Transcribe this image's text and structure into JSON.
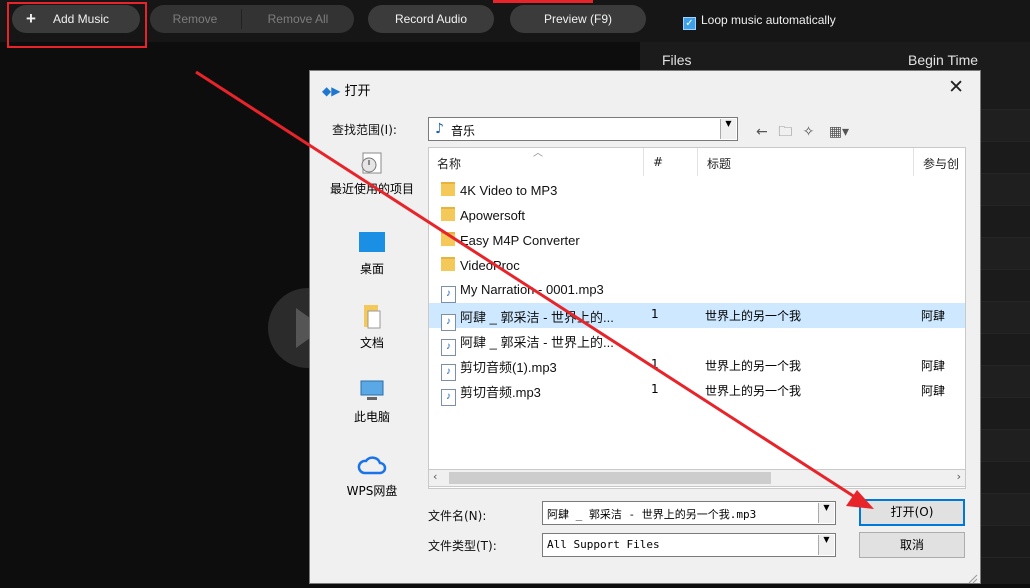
{
  "toolbar": {
    "add_music": "Add Music",
    "remove": "Remove",
    "remove_all": "Remove All",
    "record_audio": "Record Audio",
    "preview": "Preview (F9)",
    "loop_label": "Loop music automatically",
    "loop_checked": true
  },
  "right_panel": {
    "col_files": "Files",
    "col_begin": "Begin Time"
  },
  "dialog": {
    "title": "打开",
    "look_in_label": "查找范围(I):",
    "look_in_value": "音乐",
    "places": [
      {
        "label": "最近使用的项目",
        "icon": "recent-icon"
      },
      {
        "label": "桌面",
        "icon": "desktop-icon"
      },
      {
        "label": "文档",
        "icon": "documents-icon"
      },
      {
        "label": "此电脑",
        "icon": "computer-icon"
      },
      {
        "label": "WPS网盘",
        "icon": "cloud-icon"
      }
    ],
    "columns": {
      "name": "名称",
      "num": "#",
      "title": "标题",
      "artist": "参与创"
    },
    "files": [
      {
        "name": "4K Video to MP3",
        "type": "folder",
        "num": "",
        "title": "",
        "artist": ""
      },
      {
        "name": "Apowersoft",
        "type": "folder",
        "num": "",
        "title": "",
        "artist": ""
      },
      {
        "name": "Easy M4P Converter",
        "type": "folder",
        "num": "",
        "title": "",
        "artist": ""
      },
      {
        "name": "VideoProc",
        "type": "folder",
        "num": "",
        "title": "",
        "artist": ""
      },
      {
        "name": "My Narration - 0001.mp3",
        "type": "audio",
        "num": "",
        "title": "",
        "artist": ""
      },
      {
        "name": "阿肆 _ 郭采洁 - 世界上的...",
        "type": "audio",
        "num": "1",
        "title": "世界上的另一个我",
        "artist": "阿肆",
        "selected": true
      },
      {
        "name": "阿肆 _ 郭采洁 - 世界上的...",
        "type": "audio",
        "num": "",
        "title": "",
        "artist": ""
      },
      {
        "name": "剪切音频(1).mp3",
        "type": "audio",
        "num": "1",
        "title": "世界上的另一个我",
        "artist": "阿肆"
      },
      {
        "name": "剪切音频.mp3",
        "type": "audio",
        "num": "1",
        "title": "世界上的另一个我",
        "artist": "阿肆"
      }
    ],
    "filename_label": "文件名(N):",
    "filename_value": "阿肆 _ 郭采洁 - 世界上的另一个我.mp3",
    "filetype_label": "文件类型(T):",
    "filetype_value": "All Support Files",
    "open_button": "打开(O)",
    "cancel_button": "取消"
  }
}
